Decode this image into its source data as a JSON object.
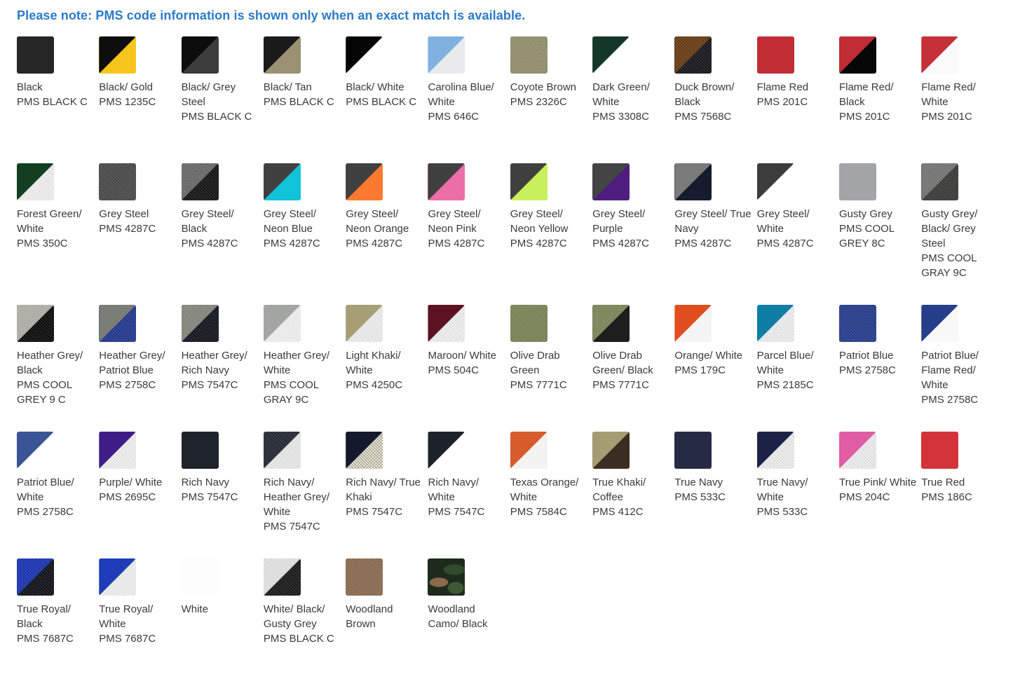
{
  "notice": "Please note: PMS code information is shown only when an exact match is available.",
  "colors": [
    {
      "name": "Black",
      "pms": "PMS BLACK C",
      "a": "#262626",
      "b": "#262626",
      "tex": ""
    },
    {
      "name": "Black/ Gold",
      "pms": "PMS 1235C",
      "a": "#0e0e0e",
      "b": "#f7c51c",
      "tex": ""
    },
    {
      "name": "Black/ Grey Steel",
      "pms": "PMS BLACK C",
      "a": "#0c0c0c",
      "b": "#3c3c3c",
      "tex": ""
    },
    {
      "name": "Black/ Tan",
      "pms": "PMS BLACK C",
      "a": "#1a1a1a",
      "b": "#9a9172",
      "tex": ""
    },
    {
      "name": "Black/ White",
      "pms": "PMS BLACK C",
      "a": "#050505",
      "b": "#ffffff",
      "tex": ""
    },
    {
      "name": "Carolina Blue/ White",
      "pms": "PMS 646C",
      "a": "#81b1e0",
      "b": "#e8eaec",
      "tex": ""
    },
    {
      "name": "Coyote Brown",
      "pms": "PMS 2326C",
      "a": "#94906f",
      "b": "#94906f",
      "tex": "tex"
    },
    {
      "name": "Dark Green/ White",
      "pms": "PMS 3308C",
      "a": "#14372a",
      "b": "#ffffff",
      "tex": ""
    },
    {
      "name": "Duck Brown/ Black",
      "pms": "PMS 7568C",
      "a": "#6a3c12",
      "b": "#16181c",
      "tex": "tex"
    },
    {
      "name": "Flame Red",
      "pms": "PMS 201C",
      "a": "#c22c34",
      "b": "#c22c34",
      "tex": ""
    },
    {
      "name": "Flame Red/ Black",
      "pms": "PMS 201C",
      "a": "#c22c34",
      "b": "#070707",
      "tex": ""
    },
    {
      "name": "Flame Red/ White",
      "pms": "PMS 201C",
      "a": "#c63038",
      "b": "#fafafa",
      "tex": ""
    },
    {
      "name": "Forest Green/ White",
      "pms": "PMS 350C",
      "a": "#123f22",
      "b": "#e6e6e6",
      "tex": "mesh"
    },
    {
      "name": "Grey Steel",
      "pms": "PMS 4287C",
      "a": "#4a4a4a",
      "b": "#4a4a4a",
      "tex": "tex"
    },
    {
      "name": "Grey Steel/ Black",
      "pms": "PMS 4287C",
      "a": "#6a6a6a",
      "b": "#151515",
      "tex": "tex"
    },
    {
      "name": "Grey Steel/ Neon Blue",
      "pms": "PMS 4287C",
      "a": "#404040",
      "b": "#11c3d6",
      "tex": ""
    },
    {
      "name": "Grey Steel/ Neon Orange",
      "pms": "PMS 4287C",
      "a": "#404040",
      "b": "#fb7a30",
      "tex": ""
    },
    {
      "name": "Grey Steel/ Neon Pink",
      "pms": "PMS 4287C",
      "a": "#404040",
      "b": "#ec6ea8",
      "tex": ""
    },
    {
      "name": "Grey Steel/ Neon Yellow",
      "pms": "PMS 4287C",
      "a": "#404040",
      "b": "#c8f05a",
      "tex": ""
    },
    {
      "name": "Grey Steel/ Purple",
      "pms": "PMS 4287C",
      "a": "#444444",
      "b": "#4e1e7e",
      "tex": ""
    },
    {
      "name": "Grey Steel/ True Navy",
      "pms": "PMS 4287C",
      "a": "#7a7a7a",
      "b": "#141c2e",
      "tex": ""
    },
    {
      "name": "Grey Steel/ White",
      "pms": "PMS 4287C",
      "a": "#3c3c3c",
      "b": "#ffffff",
      "tex": ""
    },
    {
      "name": "Gusty Grey",
      "pms": "PMS COOL GREY 8C",
      "a": "#a2a4a6",
      "b": "#a2a4a6",
      "tex": ""
    },
    {
      "name": "Gusty Grey/ Black/ Grey Steel",
      "pms": "PMS COOL GRAY 9C",
      "a": "#767676",
      "b": "#3a3a38",
      "tex": "tex"
    },
    {
      "name": "Heather Grey/ Black",
      "pms": "PMS COOL GREY 9 C",
      "a": "#b2b2aa",
      "b": "#0b0b0b",
      "tex": "tex"
    },
    {
      "name": "Heather Grey/ Patriot Blue",
      "pms": "PMS 2758C",
      "a": "#777a72",
      "b": "#22388e",
      "tex": "tex"
    },
    {
      "name": "Heather Grey/ Rich Navy",
      "pms": "PMS 7547C",
      "a": "#86877e",
      "b": "#12161e",
      "tex": "tex"
    },
    {
      "name": "Heather Grey/ White",
      "pms": "PMS COOL GRAY 9C",
      "a": "#a4a6a0",
      "b": "#f2f2f2",
      "tex": "tex"
    },
    {
      "name": "Light Khaki/ White",
      "pms": "PMS 4250C",
      "a": "#a69f76",
      "b": "#e2e2e2",
      "tex": "mesh"
    },
    {
      "name": "Maroon/ White",
      "pms": "PMS 504C",
      "a": "#5c1222",
      "b": "#e4e4e4",
      "tex": "mesh"
    },
    {
      "name": "Olive Drab Green",
      "pms": "PMS 7771C",
      "a": "#7b8456",
      "b": "#7b8456",
      "tex": "tex"
    },
    {
      "name": "Olive Drab Green/ Black",
      "pms": "PMS 7771C",
      "a": "#7f8a5e",
      "b": "#1e1e1e",
      "tex": ""
    },
    {
      "name": "Orange/ White",
      "pms": "PMS 179C",
      "a": "#e04e20",
      "b": "#f4f4f4",
      "tex": ""
    },
    {
      "name": "Parcel Blue/ White",
      "pms": "PMS 2185C",
      "a": "#0e7ea6",
      "b": "#e2e2e2",
      "tex": "mesh"
    },
    {
      "name": "Patriot Blue",
      "pms": "PMS 2758C",
      "a": "#253d8c",
      "b": "#253d8c",
      "tex": "tex"
    },
    {
      "name": "Patriot Blue/ Flame Red/ White",
      "pms": "PMS 2758C",
      "a": "#263f8a",
      "b": "#f8f8f8",
      "tex": ""
    },
    {
      "name": "Patriot Blue/ White",
      "pms": "PMS 2758C",
      "a": "#3b5496",
      "b": "#ffffff",
      "tex": ""
    },
    {
      "name": "Purple/ White",
      "pms": "PMS 2695C",
      "a": "#3e1e86",
      "b": "#e6e6e6",
      "tex": "mesh"
    },
    {
      "name": "Rich Navy",
      "pms": "PMS 7547C",
      "a": "#1e232c",
      "b": "#1e232c",
      "tex": ""
    },
    {
      "name": "Rich Navy/ Heather Grey/ White",
      "pms": "PMS 7547C",
      "a": "#232832",
      "b": "#eaeaea",
      "tex": "tex"
    },
    {
      "name": "Rich Navy/ True Khaki",
      "pms": "PMS 7547C",
      "a": "#121a2c",
      "b": "#a8a280",
      "tex": "mesh"
    },
    {
      "name": "Rich Navy/ White",
      "pms": "PMS 7547C",
      "a": "#1c212a",
      "b": "#ffffff",
      "tex": ""
    },
    {
      "name": "Texas Orange/ White",
      "pms": "PMS 7584C",
      "a": "#d65c2c",
      "b": "#f2f2f2",
      "tex": ""
    },
    {
      "name": "True Khaki/ Coffee",
      "pms": "PMS 412C",
      "a": "#a69c74",
      "b": "#3a2e22",
      "tex": ""
    },
    {
      "name": "True Navy",
      "pms": "PMS 533C",
      "a": "#262a44",
      "b": "#262a44",
      "tex": ""
    },
    {
      "name": "True Navy/ White",
      "pms": "PMS 533C",
      "a": "#1c2246",
      "b": "#e0e0e0",
      "tex": "mesh"
    },
    {
      "name": "True Pink/ White",
      "pms": "PMS 204C",
      "a": "#e05ca4",
      "b": "#e0e0e0",
      "tex": "mesh"
    },
    {
      "name": "True Red",
      "pms": "PMS 186C",
      "a": "#d2343a",
      "b": "#d2343a",
      "tex": ""
    },
    {
      "name": "True Royal/ Black",
      "pms": "PMS 7687C",
      "a": "#1a34b4",
      "b": "#101218",
      "tex": "tex"
    },
    {
      "name": "True Royal/ White",
      "pms": "PMS 7687C",
      "a": "#1e3cb8",
      "b": "#e6e6e6",
      "tex": "mesh"
    },
    {
      "name": "White",
      "pms": "",
      "a": "#fdfdfd",
      "b": "#fdfdfd",
      "tex": ""
    },
    {
      "name": "White/ Black/ Gusty Grey",
      "pms": "PMS BLACK C",
      "a": "#e4e4e4",
      "b": "#1a1a1a",
      "tex": "tex"
    },
    {
      "name": "Woodland Brown",
      "pms": "",
      "a": "#8b6c50",
      "b": "#8b6c50",
      "tex": "tex"
    },
    {
      "name": "Woodland Camo/ Black",
      "pms": "",
      "a": "camo",
      "b": "camo",
      "tex": "camo"
    }
  ]
}
